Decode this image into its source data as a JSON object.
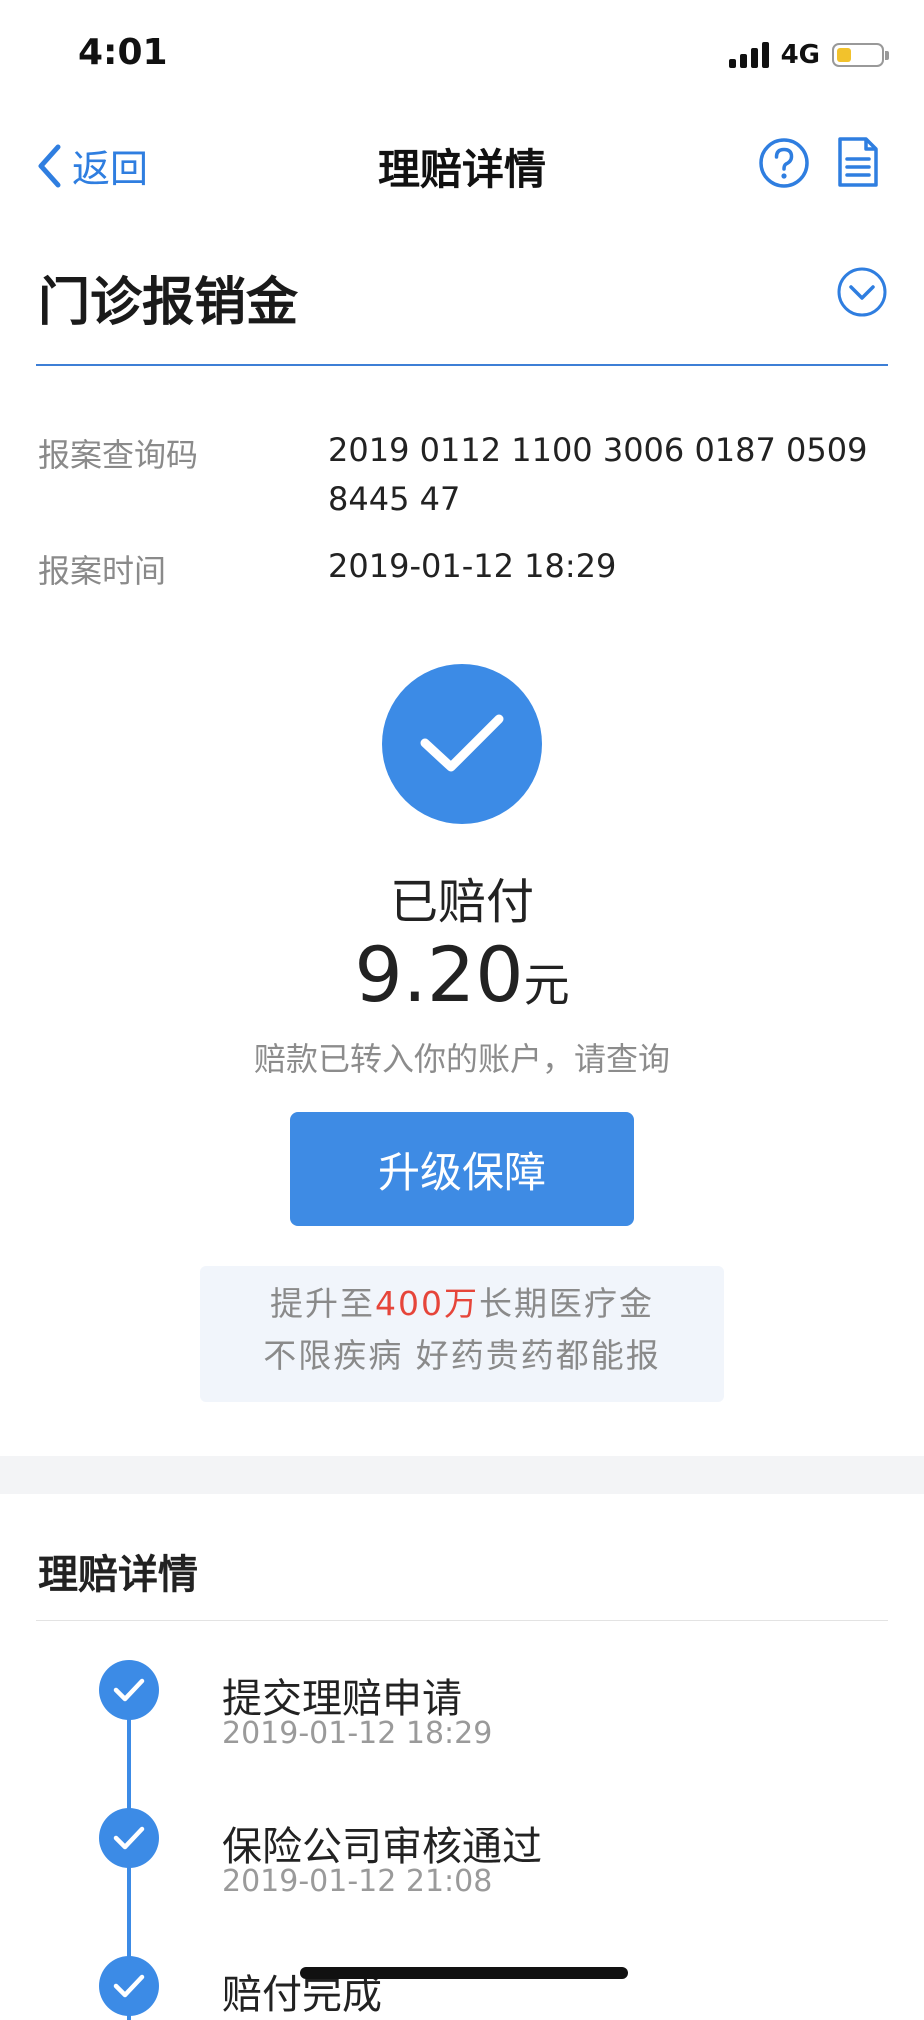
{
  "status_bar": {
    "time": "4:01",
    "network": "4G",
    "battery_level": 0.3
  },
  "nav": {
    "back_label": "返回",
    "title": "理赔详情"
  },
  "product": {
    "title": "门诊报销金"
  },
  "info": {
    "query_code_label": "报案查询码",
    "query_code_value": "2019 0112 1100 3006 0187 0509 8445 47",
    "time_label": "报案时间",
    "time_value": "2019-01-12 18:29"
  },
  "result": {
    "status": "已赔付",
    "amount": "9.20",
    "currency": "元",
    "note": "赔款已转入你的账户，请查询"
  },
  "upgrade": {
    "button_label": "升级保障"
  },
  "promo": {
    "line1_prefix": "提升至",
    "line1_highlight": "400万",
    "line1_suffix": "长期医疗金",
    "line2": "不限疾病 好药贵药都能报"
  },
  "details": {
    "title": "理赔详情",
    "steps": [
      {
        "title": "提交理赔申请",
        "time": "2019-01-12 18:29"
      },
      {
        "title": "保险公司审核通过",
        "time": "2019-01-12 21:08"
      },
      {
        "title": "赔付完成"
      }
    ]
  },
  "colors": {
    "accent": "#3c8be6",
    "highlight": "#e6453a",
    "divider": "#3d7fd6"
  }
}
